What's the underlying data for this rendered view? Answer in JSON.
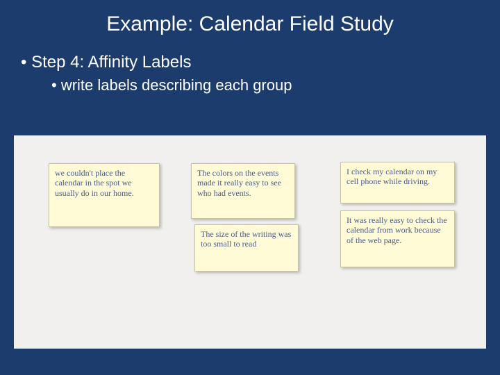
{
  "title": "Example: Calendar Field Study",
  "bullets": {
    "level1": "Step 4: Affinity Labels",
    "level2": "write labels describing each group"
  },
  "notes": {
    "n1": "we couldn't place the calendar in the spot we usually do in our home.",
    "n2": "The colors on the events made it really easy to see who had events.",
    "n3": "The size of the writing was too small to read",
    "n4": "I check my calendar on my cell phone while driving.",
    "n5": "It was really easy to check the calendar from work because of the web page."
  }
}
